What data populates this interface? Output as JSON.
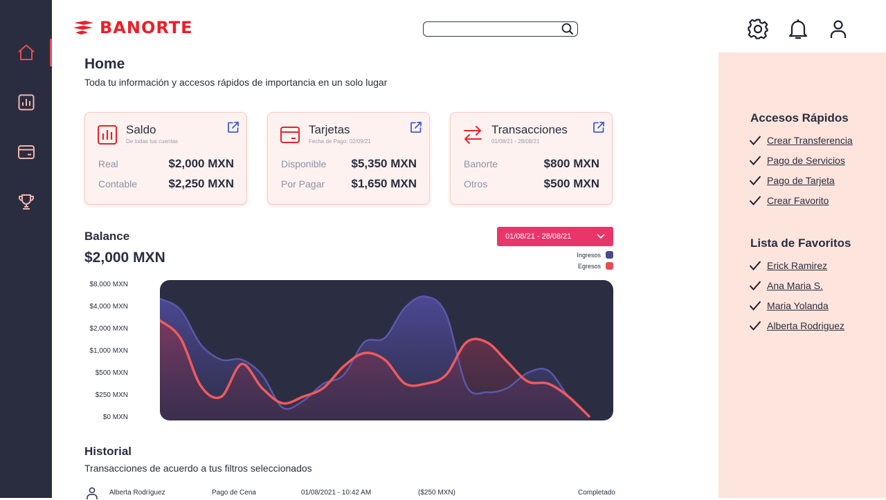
{
  "brand": {
    "name": "BANORTE",
    "color": "#e8202a"
  },
  "sidebar": {
    "items": [
      {
        "id": "home",
        "icon": "home-icon",
        "active": true
      },
      {
        "id": "reports",
        "icon": "chart-icon",
        "active": false
      },
      {
        "id": "cards",
        "icon": "card-icon",
        "active": false
      },
      {
        "id": "rewards",
        "icon": "trophy-icon",
        "active": false
      }
    ]
  },
  "header": {
    "search_placeholder": "",
    "icons": [
      "gear-icon",
      "bell-icon",
      "user-icon"
    ]
  },
  "page": {
    "title": "Home",
    "subtitle": "Toda tu información y accesos rápidos de importancia en un solo lugar"
  },
  "cards": [
    {
      "title": "Saldo",
      "subtitle": "De todas tus cuentas",
      "rows": [
        {
          "label": "Real",
          "value": "$2,000 MXN"
        },
        {
          "label": "Contable",
          "value": "$2,250 MXN"
        }
      ]
    },
    {
      "title": "Tarjetas",
      "subtitle": "Fecha de Pago: 02/09/21",
      "rows": [
        {
          "label": "Disponible",
          "value": "$5,350 MXN"
        },
        {
          "label": "Por Pagar",
          "value": "$1,650 MXN"
        }
      ]
    },
    {
      "title": "Transacciones",
      "subtitle": "01/08/21 - 28/08/21",
      "rows": [
        {
          "label": "Banorte",
          "value": "$800 MXN"
        },
        {
          "label": "Otros",
          "value": "$500 MXN"
        }
      ]
    }
  ],
  "balance": {
    "title": "Balance",
    "amount": "$2,000 MXN",
    "date_range": "01/08/21 - 28/08/21"
  },
  "chart_data": {
    "type": "area",
    "y_ticks": [
      "$8,000 MXN",
      "$4,000 MXN",
      "$2,000 MXN",
      "$1,000 MXN",
      "$500 MXN",
      "$250 MXN",
      "$0 MXN"
    ],
    "x": [
      0,
      1,
      2,
      3,
      4,
      5,
      6,
      7,
      8,
      9,
      10,
      11,
      12,
      13,
      14,
      15,
      16,
      17,
      18,
      19,
      20,
      21
    ],
    "series": [
      {
        "name": "Ingresos",
        "color": "#4b4a8c",
        "values": [
          5.4,
          4.9,
          3.3,
          2.6,
          2.6,
          1.9,
          0.4,
          0.7,
          1.5,
          1.9,
          3.4,
          3.6,
          5.0,
          5.5,
          4.7,
          1.4,
          1.1,
          1.3,
          2.0,
          2.1,
          0.9,
          0
        ]
      },
      {
        "name": "Egresos",
        "color": "#e84b52",
        "values": [
          4.4,
          3.6,
          1.4,
          0.9,
          2.4,
          1.3,
          0.6,
          0.9,
          1.3,
          2.3,
          2.9,
          2.6,
          1.5,
          1.5,
          1.9,
          3.4,
          3.4,
          2.5,
          1.6,
          1.5,
          0.9,
          0
        ]
      }
    ],
    "legend": "top-right"
  },
  "historial": {
    "title": "Historial",
    "subtitle": "Transacciones de acuerdo a tus filtros seleccionados",
    "rows": [
      {
        "name": "Alberta Rodríguez",
        "concept": "Pago de Cena",
        "date": "01/08/2021 - 10:42 AM",
        "amount": "($250 MXN)",
        "status": "Completado"
      }
    ]
  },
  "accesos": {
    "title": "Accesos Rápidos",
    "items": [
      "Crear Transferencia",
      "Pago de Servicios",
      "Pago de Tarjeta",
      "Crear Favorito"
    ]
  },
  "favoritos": {
    "title": "Lista de Favoritos",
    "items": [
      "Erick Ramirez",
      "Ana Maria S.",
      "Maria Yolanda",
      "Alberta Rodriguez"
    ]
  },
  "colors": {
    "sidebar": "#2a2d3f",
    "accent": "#e84b52",
    "panel": "#fde4dc",
    "pink": "#e8366b"
  }
}
